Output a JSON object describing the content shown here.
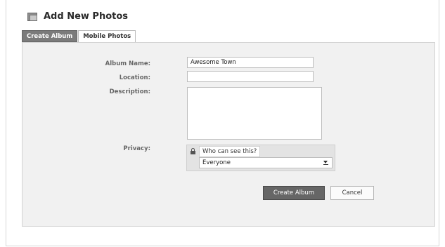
{
  "header": {
    "title": "Add New Photos",
    "icon": "photos-icon"
  },
  "tabs": [
    {
      "label": "Create Album",
      "active": true
    },
    {
      "label": "Mobile Photos",
      "active": false
    }
  ],
  "form": {
    "album_name": {
      "label": "Album Name:",
      "value": "Awesome Town"
    },
    "location": {
      "label": "Location:",
      "value": ""
    },
    "description": {
      "label": "Description:",
      "value": ""
    },
    "privacy": {
      "label": "Privacy:",
      "prompt": "Who can see this?",
      "selected": "Everyone",
      "icon": "lock-icon"
    }
  },
  "buttons": {
    "create": "Create Album",
    "cancel": "Cancel"
  },
  "colors": {
    "primary_button": "#666666",
    "active_tab": "#7b7b7b",
    "panel_bg": "#f1f1f1"
  }
}
